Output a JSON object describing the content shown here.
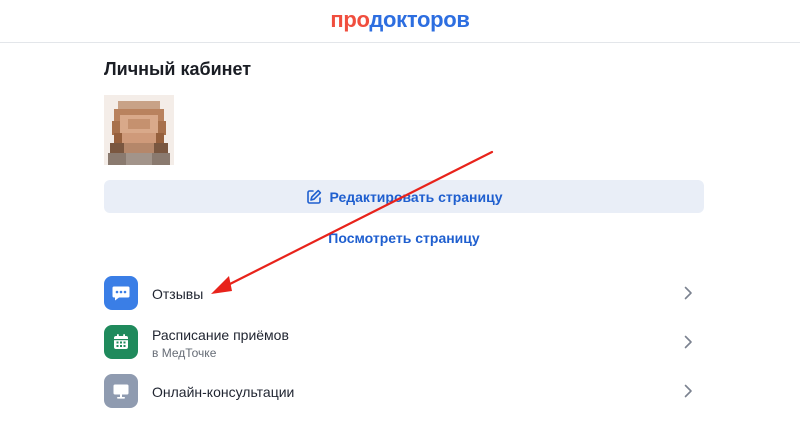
{
  "header": {
    "logo_part1": "про",
    "logo_part2": "докторов",
    "logo_color_1": "#f04e3e",
    "logo_color_2": "#2d6ee0"
  },
  "profile": {
    "page_title": "Личный кабинет",
    "avatar_icon": "blurred-photo",
    "name": ""
  },
  "actions": {
    "edit_label": "Редактировать страницу",
    "edit_icon": "edit-icon",
    "view_label": "Посмотреть страницу"
  },
  "menu": {
    "items": [
      {
        "label": "Отзывы",
        "sub": "",
        "icon": "chat-bubble-icon",
        "color": "#3a7ee6"
      },
      {
        "label": "Расписание приёмов",
        "sub": "в МедТочке",
        "icon": "calendar-icon",
        "color": "#1f8a5c"
      },
      {
        "label": "Онлайн-консультации",
        "sub": "",
        "icon": "monitor-icon",
        "color": "#8f9bb0"
      }
    ]
  },
  "annotation": {
    "arrow_color": "#e8231b"
  }
}
